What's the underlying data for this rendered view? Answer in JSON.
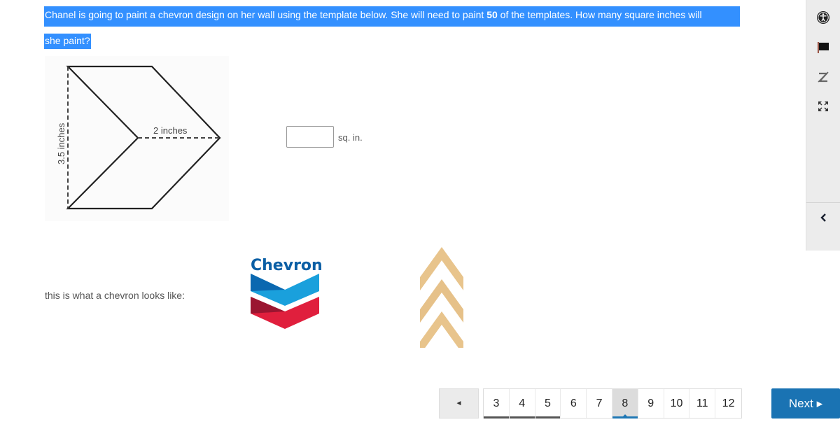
{
  "question": {
    "line1_before": "Chanel is going to paint a chevron design on her wall using the template below. She will need to paint ",
    "line1_bold": "50",
    "line1_after": " of the templates. How many square inches will",
    "line2": "she paint?",
    "highlight_color": "#3390ff"
  },
  "figure": {
    "height_label": "3.5 inches",
    "width_label": "2 inches"
  },
  "answer": {
    "value": "",
    "unit": "sq. in."
  },
  "caption": "this is what a chevron looks like:",
  "logo": {
    "text": "Chevron",
    "colors": {
      "blue": "#1aa0dc",
      "dark_blue": "#0b68b0",
      "red": "#e01f3d",
      "dark_red": "#9a1530",
      "text": "#0b5fa5"
    }
  },
  "sidebar": {
    "icons": [
      "accessibility-icon",
      "flag-icon",
      "translate-icon",
      "fullscreen-icon"
    ],
    "collapse": "chevron-left-icon"
  },
  "pager": {
    "prev_symbol": "◄",
    "pages": [
      {
        "label": "3",
        "state": "answered"
      },
      {
        "label": "4",
        "state": "answered"
      },
      {
        "label": "5",
        "state": "answered"
      },
      {
        "label": "6",
        "state": ""
      },
      {
        "label": "7",
        "state": ""
      },
      {
        "label": "8",
        "state": "current"
      },
      {
        "label": "9",
        "state": ""
      },
      {
        "label": "10",
        "state": ""
      },
      {
        "label": "11",
        "state": ""
      },
      {
        "label": "12",
        "state": ""
      }
    ],
    "next_label": "Next ▸",
    "next_color": "#1a73b3"
  }
}
